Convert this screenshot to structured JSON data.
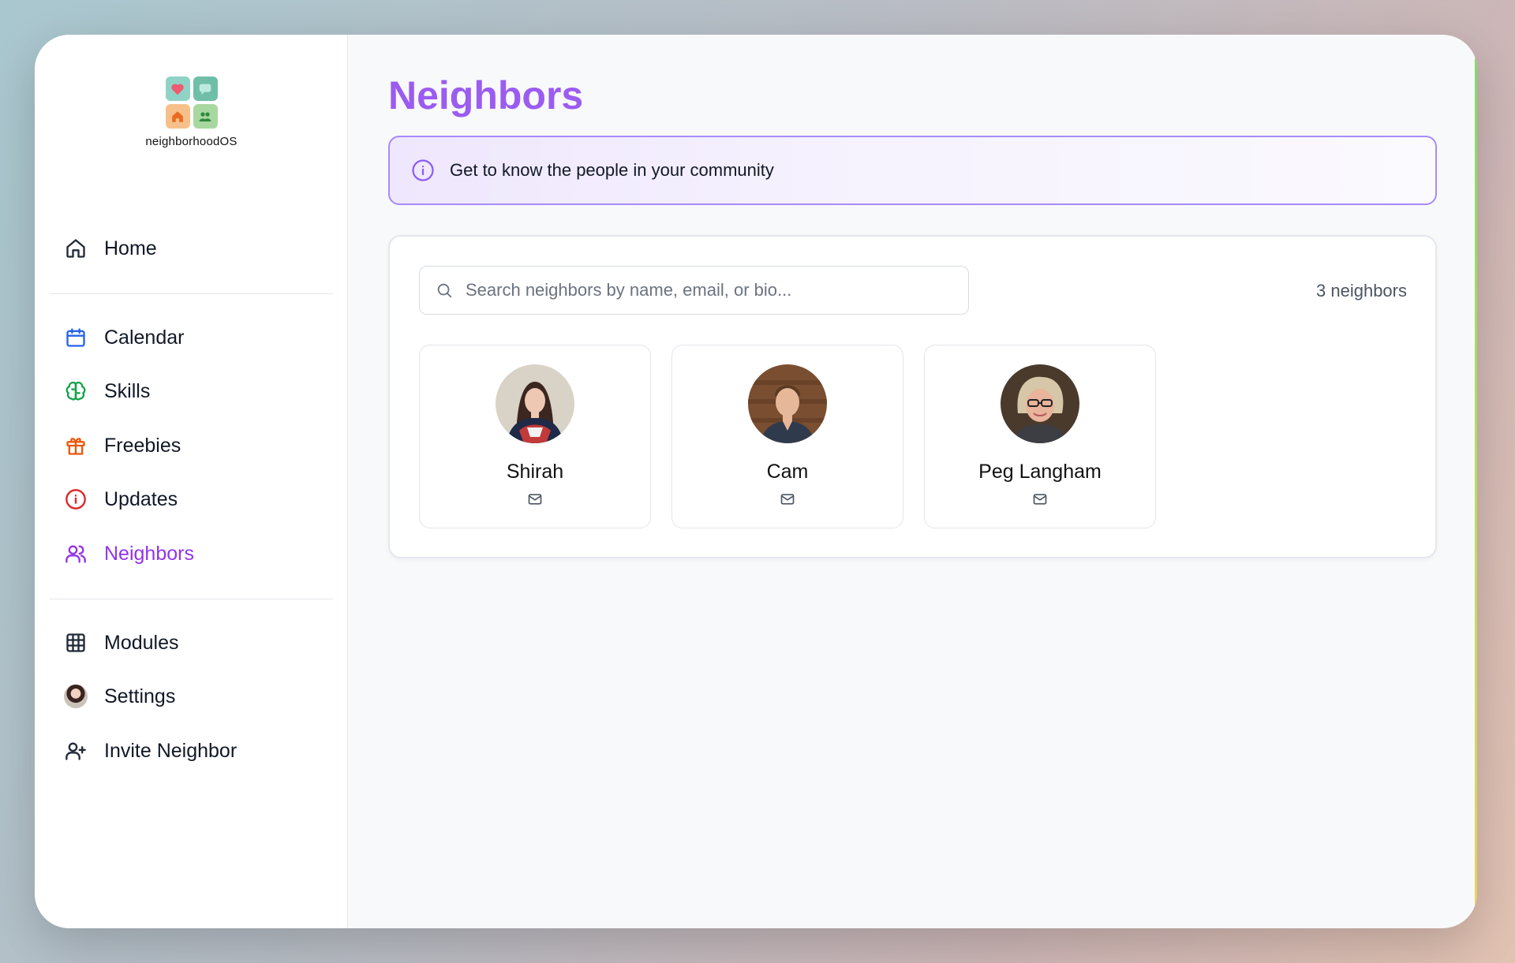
{
  "app": {
    "logo_text": "neighborhoodOS"
  },
  "sidebar": {
    "items": [
      {
        "label": "Home",
        "icon": "home-icon"
      },
      {
        "label": "Calendar",
        "icon": "calendar-icon",
        "color": "#2563eb"
      },
      {
        "label": "Skills",
        "icon": "brain-icon",
        "color": "#16a34a"
      },
      {
        "label": "Freebies",
        "icon": "gift-icon",
        "color": "#ea580c"
      },
      {
        "label": "Updates",
        "icon": "info-circle-icon",
        "color": "#dc2626"
      },
      {
        "label": "Neighbors",
        "icon": "users-icon",
        "color": "#9333ea",
        "active": true
      },
      {
        "label": "Modules",
        "icon": "grid-icon"
      },
      {
        "label": "Settings",
        "icon": "avatar"
      },
      {
        "label": "Invite Neighbor",
        "icon": "user-plus-icon"
      }
    ]
  },
  "main": {
    "title": "Neighbors",
    "banner_text": "Get to know the people in your community",
    "search_placeholder": "Search neighbors by name, email, or bio...",
    "count_text": "3 neighbors",
    "neighbors": [
      {
        "name": "Shirah"
      },
      {
        "name": "Cam"
      },
      {
        "name": "Peg Langham"
      }
    ]
  },
  "colors": {
    "accent": "#9b5cf0",
    "banner_border": "#a78bfa"
  }
}
